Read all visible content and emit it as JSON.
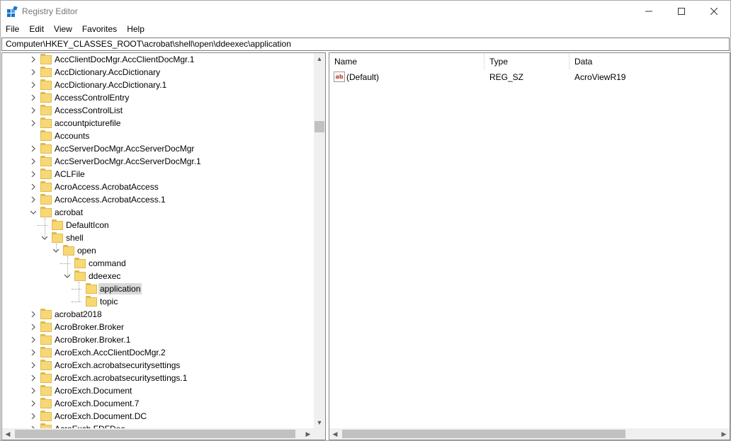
{
  "window": {
    "title": "Registry Editor",
    "controls": {
      "minimize": "—",
      "maximize": "☐",
      "close": "✕"
    }
  },
  "menu": [
    "File",
    "Edit",
    "View",
    "Favorites",
    "Help"
  ],
  "address": "Computer\\HKEY_CLASSES_ROOT\\acrobat\\shell\\open\\ddeexec\\application",
  "tree": {
    "nodes": [
      {
        "label": "AccClientDocMgr.AccClientDocMgr.1",
        "level": 0,
        "expander": "collapsed"
      },
      {
        "label": "AccDictionary.AccDictionary",
        "level": 0,
        "expander": "collapsed"
      },
      {
        "label": "AccDictionary.AccDictionary.1",
        "level": 0,
        "expander": "collapsed"
      },
      {
        "label": "AccessControlEntry",
        "level": 0,
        "expander": "collapsed"
      },
      {
        "label": "AccessControlList",
        "level": 0,
        "expander": "collapsed"
      },
      {
        "label": "accountpicturefile",
        "level": 0,
        "expander": "collapsed"
      },
      {
        "label": "Accounts",
        "level": 0,
        "expander": "none"
      },
      {
        "label": "AccServerDocMgr.AccServerDocMgr",
        "level": 0,
        "expander": "collapsed"
      },
      {
        "label": "AccServerDocMgr.AccServerDocMgr.1",
        "level": 0,
        "expander": "collapsed"
      },
      {
        "label": "ACLFile",
        "level": 0,
        "expander": "collapsed"
      },
      {
        "label": "AcroAccess.AcrobatAccess",
        "level": 0,
        "expander": "collapsed"
      },
      {
        "label": "AcroAccess.AcrobatAccess.1",
        "level": 0,
        "expander": "collapsed"
      },
      {
        "label": "acrobat",
        "level": 0,
        "expander": "expanded"
      },
      {
        "label": "DefaultIcon",
        "level": 1,
        "expander": "none"
      },
      {
        "label": "shell",
        "level": 1,
        "expander": "expanded"
      },
      {
        "label": "open",
        "level": 2,
        "expander": "expanded"
      },
      {
        "label": "command",
        "level": 3,
        "expander": "none"
      },
      {
        "label": "ddeexec",
        "level": 3,
        "expander": "expanded"
      },
      {
        "label": "application",
        "level": 4,
        "expander": "none",
        "selected": true
      },
      {
        "label": "topic",
        "level": 4,
        "expander": "none"
      },
      {
        "label": "acrobat2018",
        "level": 0,
        "expander": "collapsed"
      },
      {
        "label": "AcroBroker.Broker",
        "level": 0,
        "expander": "collapsed"
      },
      {
        "label": "AcroBroker.Broker.1",
        "level": 0,
        "expander": "collapsed"
      },
      {
        "label": "AcroExch.AccClientDocMgr.2",
        "level": 0,
        "expander": "collapsed"
      },
      {
        "label": "AcroExch.acrobatsecuritysettings",
        "level": 0,
        "expander": "collapsed"
      },
      {
        "label": "AcroExch.acrobatsecuritysettings.1",
        "level": 0,
        "expander": "collapsed"
      },
      {
        "label": "AcroExch.Document",
        "level": 0,
        "expander": "collapsed"
      },
      {
        "label": "AcroExch.Document.7",
        "level": 0,
        "expander": "collapsed"
      },
      {
        "label": "AcroExch.Document.DC",
        "level": 0,
        "expander": "collapsed"
      },
      {
        "label": "AcroExch.FDFDoc",
        "level": 0,
        "expander": "collapsed"
      }
    ]
  },
  "list": {
    "columns": {
      "name": "Name",
      "type": "Type",
      "data": "Data"
    },
    "rows": [
      {
        "icon": "ab",
        "name": "(Default)",
        "type": "REG_SZ",
        "data": "AcroViewR19"
      }
    ]
  },
  "scroll": {
    "up": "▲",
    "down": "▼",
    "left": "◀",
    "right": "▶"
  }
}
